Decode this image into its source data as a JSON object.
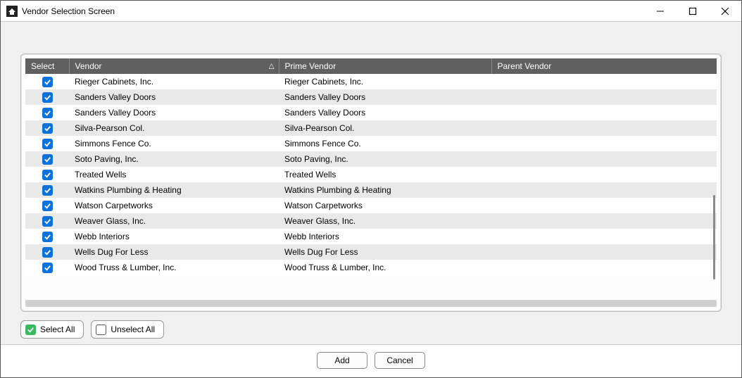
{
  "window": {
    "title": "Vendor Selection Screen"
  },
  "columns": {
    "select": "Select",
    "vendor": "Vendor",
    "prime": "Prime Vendor",
    "parent": "Parent Vendor"
  },
  "sort": {
    "column": "vendor",
    "direction": "asc",
    "indicator": "△"
  },
  "rows": [
    {
      "checked": true,
      "vendor": "Rieger Cabinets, Inc.",
      "prime": "Rieger Cabinets, Inc.",
      "parent": ""
    },
    {
      "checked": true,
      "vendor": "Sanders Valley Doors",
      "prime": "Sanders Valley Doors",
      "parent": ""
    },
    {
      "checked": true,
      "vendor": "Sanders Valley Doors",
      "prime": "Sanders Valley Doors",
      "parent": ""
    },
    {
      "checked": true,
      "vendor": "Silva-Pearson Col.",
      "prime": "Silva-Pearson Col.",
      "parent": ""
    },
    {
      "checked": true,
      "vendor": "Simmons Fence Co.",
      "prime": "Simmons Fence Co.",
      "parent": ""
    },
    {
      "checked": true,
      "vendor": "Soto Paving, Inc.",
      "prime": "Soto Paving, Inc.",
      "parent": ""
    },
    {
      "checked": true,
      "vendor": "Treated Wells",
      "prime": "Treated Wells",
      "parent": ""
    },
    {
      "checked": true,
      "vendor": "Watkins Plumbing & Heating",
      "prime": "Watkins Plumbing & Heating",
      "parent": ""
    },
    {
      "checked": true,
      "vendor": "Watson Carpetworks",
      "prime": "Watson Carpetworks",
      "parent": ""
    },
    {
      "checked": true,
      "vendor": "Weaver Glass, Inc.",
      "prime": "Weaver Glass, Inc.",
      "parent": ""
    },
    {
      "checked": true,
      "vendor": "Webb Interiors",
      "prime": "Webb Interiors",
      "parent": ""
    },
    {
      "checked": true,
      "vendor": "Wells Dug For Less",
      "prime": "Wells Dug For Less",
      "parent": ""
    },
    {
      "checked": true,
      "vendor": "Wood Truss & Lumber, Inc.",
      "prime": "Wood Truss & Lumber, Inc.",
      "parent": ""
    }
  ],
  "buttons": {
    "select_all": "Select All",
    "unselect_all": "Unselect All",
    "add": "Add",
    "cancel": "Cancel"
  },
  "colors": {
    "checkbox_blue": "#0a72d8",
    "select_all_green": "#3cb95f",
    "header_bg": "#606060",
    "row_alt": "#e9e9e9"
  }
}
